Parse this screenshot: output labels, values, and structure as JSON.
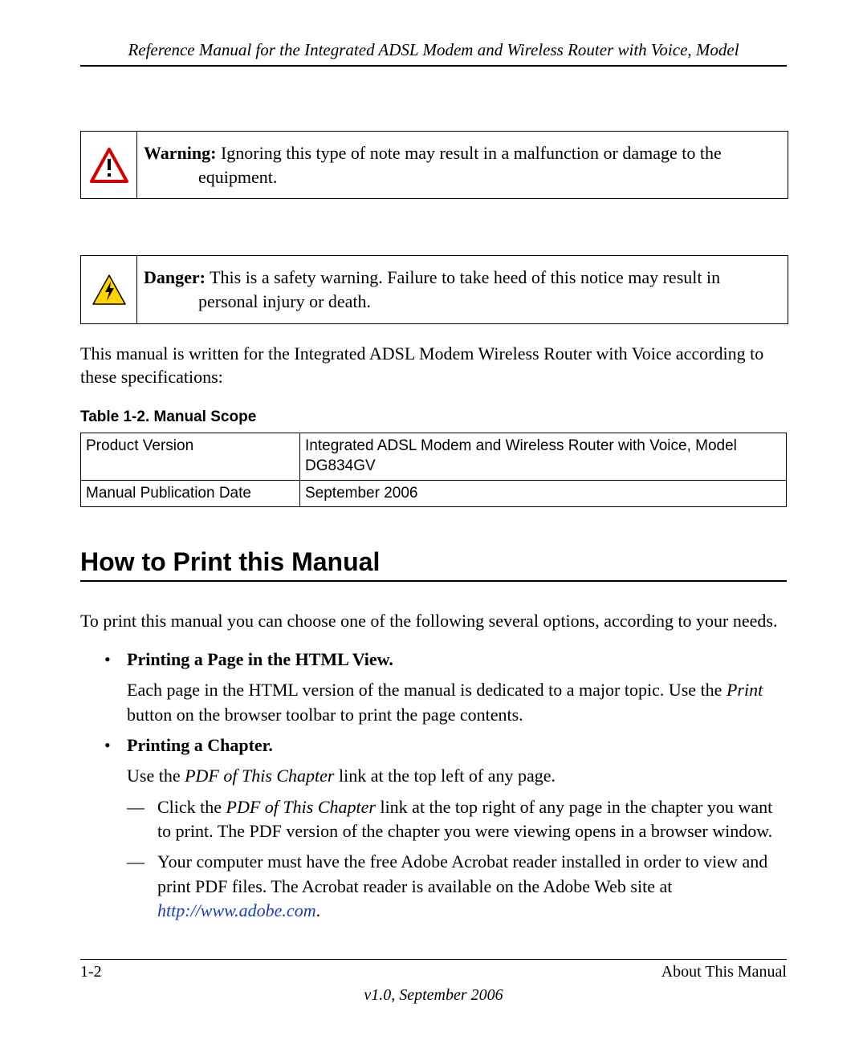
{
  "header": {
    "running_head": "Reference Manual for the Integrated ADSL Modem and Wireless Router with Voice, Model"
  },
  "callouts": {
    "warning": {
      "label": "Warning:",
      "text_line1": " Ignoring this type of note may result in a malfunction or damage to the",
      "text_line2": "equipment."
    },
    "danger": {
      "label": "Danger:",
      "text_line1": " This is a safety warning. Failure to take heed of this notice may result in",
      "text_line2": "personal injury or death."
    }
  },
  "body": {
    "intro_para": "This manual is written for the Integrated ADSL Modem Wireless Router with Voice according to these specifications:"
  },
  "table": {
    "caption": "Table 1-2. Manual Scope",
    "rows": [
      {
        "key": "Product Version",
        "value": "Integrated ADSL Modem and Wireless Router with Voice, Model DG834GV"
      },
      {
        "key": "Manual Publication Date",
        "value": "September 2006"
      }
    ]
  },
  "section": {
    "heading": "How to Print this Manual",
    "lead": "To print this manual you can choose one of the following several options, according to your needs.",
    "items": [
      {
        "head": "Printing a Page in the HTML View",
        "body_pre": "Each page in the HTML version of the manual is dedicated to a major topic. Use the ",
        "body_emph": "Print",
        "body_post": " button on the browser toolbar to print the page contents."
      },
      {
        "head": "Printing a Chapter",
        "body_pre": "Use the ",
        "body_emph": "PDF of This Chapter",
        "body_post": " link at the top left of any page.",
        "subitems": [
          {
            "pre": "Click the ",
            "emph": "PDF of This Chapter",
            "post": " link at the top right of any page in the chapter you want to print. The PDF version of the chapter you were viewing opens in a browser window."
          },
          {
            "pre": "Your computer must have the free Adobe Acrobat reader installed in order to view and print PDF files. The Acrobat reader is available on the Adobe Web site at ",
            "link_text": "http://www.adobe.com",
            "post": "."
          }
        ]
      }
    ]
  },
  "footer": {
    "page_num": "1-2",
    "chapter": "About This Manual",
    "version": "v1.0, September 2006"
  }
}
